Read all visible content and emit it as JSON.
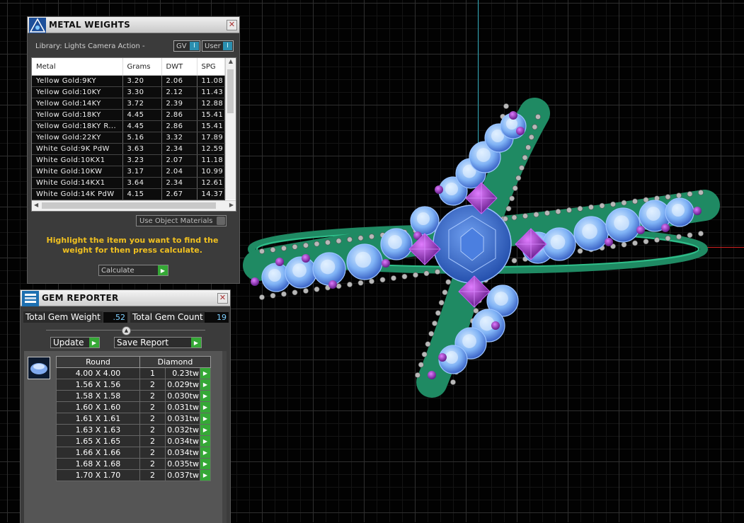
{
  "metal_weights": {
    "title": "METAL WEIGHTS",
    "library": "Library: Lights Camera Action -",
    "toggle_gv": "GV",
    "toggle_user": "User",
    "columns": [
      "Metal",
      "Grams",
      "DWT",
      "SPG"
    ],
    "rows": [
      [
        "Yellow Gold:9KY",
        "3.20",
        "2.06",
        "11.08"
      ],
      [
        "Yellow Gold:10KY",
        "3.30",
        "2.12",
        "11.43"
      ],
      [
        "Yellow Gold:14KY",
        "3.72",
        "2.39",
        "12.88"
      ],
      [
        "Yellow Gold:18KY",
        "4.45",
        "2.86",
        "15.41"
      ],
      [
        "Yellow Gold:18KY R...",
        "4.45",
        "2.86",
        "15.41"
      ],
      [
        "Yellow Gold:22KY",
        "5.16",
        "3.32",
        "17.89"
      ],
      [
        "White Gold:9K PdW",
        "3.63",
        "2.34",
        "12.59"
      ],
      [
        "White Gold:10KX1",
        "3.23",
        "2.07",
        "11.18"
      ],
      [
        "White Gold:10KW",
        "3.17",
        "2.04",
        "10.99"
      ],
      [
        "White Gold:14KX1",
        "3.64",
        "2.34",
        "12.61"
      ],
      [
        "White Gold:14K PdW",
        "4.15",
        "2.67",
        "14.37"
      ]
    ],
    "use_object_materials": "Use Object Materials",
    "instruction": "Highlight the item you want to find the weight for then press calculate.",
    "calculate": "Calculate"
  },
  "gem_reporter": {
    "title": "GEM REPORTER",
    "total_weight_label": "Total Gem Weight",
    "total_weight_value": ".52",
    "total_count_label": "Total Gem Count",
    "total_count_value": "19",
    "update": "Update",
    "save_report": "Save Report",
    "shape_header": "Round",
    "material_header": "Diamond",
    "rows": [
      [
        "4.00 X 4.00",
        "1",
        "0.23tw"
      ],
      [
        "1.56 X 1.56",
        "2",
        "0.029tw"
      ],
      [
        "1.58 X 1.58",
        "2",
        "0.030tw"
      ],
      [
        "1.60 X 1.60",
        "2",
        "0.031tw"
      ],
      [
        "1.61 X 1.61",
        "2",
        "0.031tw"
      ],
      [
        "1.63 X 1.63",
        "2",
        "0.032tw"
      ],
      [
        "1.65 X 1.65",
        "2",
        "0.034tw"
      ],
      [
        "1.66 X 1.66",
        "2",
        "0.034tw"
      ],
      [
        "1.68 X 1.68",
        "2",
        "0.035tw"
      ],
      [
        "1.70 X 1.70",
        "2",
        "0.037tw"
      ]
    ]
  },
  "colors": {
    "instruction_text": "#f0c020",
    "go_button": "#35a836",
    "band": "#1f8a63",
    "gem": "#5f8fe0",
    "accent_gem": "#8a2bb0"
  }
}
